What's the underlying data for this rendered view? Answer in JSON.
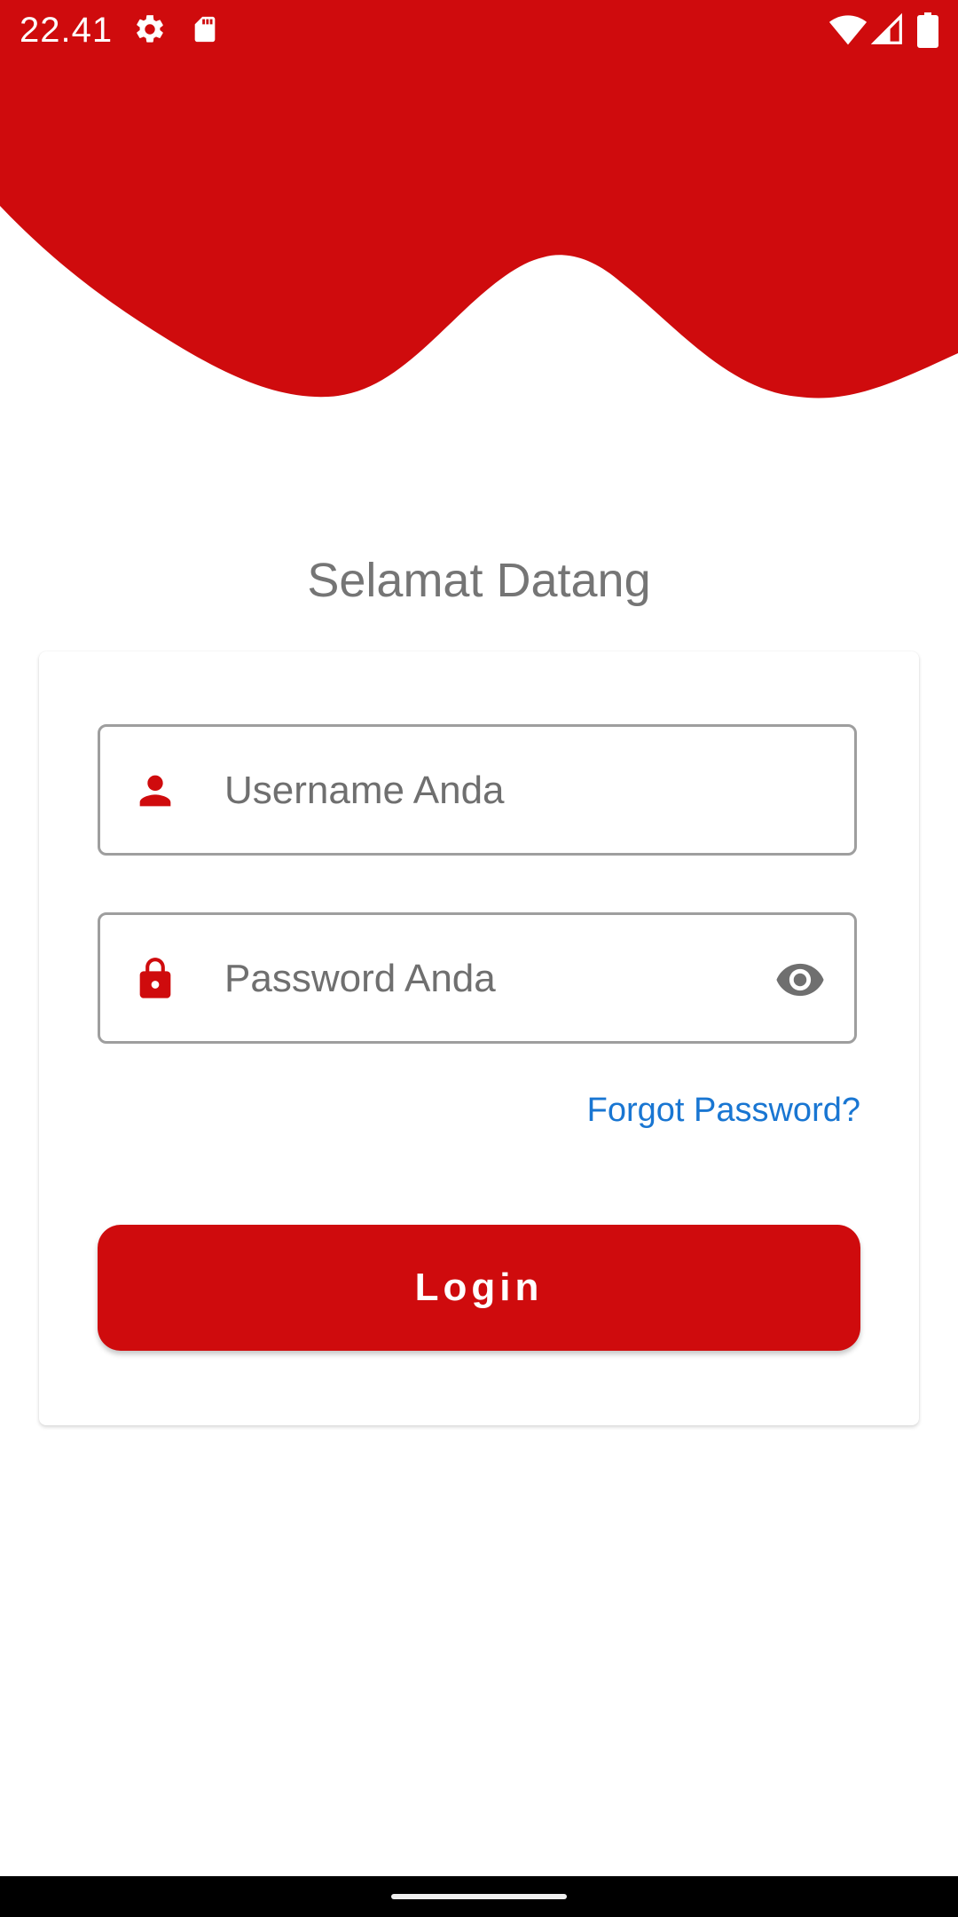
{
  "status_bar": {
    "time": "22.41",
    "icons": [
      "gear-icon",
      "sd-card-icon",
      "wifi-icon",
      "signal-icon",
      "battery-icon"
    ]
  },
  "header": {
    "wave_color": "#cf0b0d"
  },
  "welcome_title": "Selamat Datang",
  "login_form": {
    "username": {
      "placeholder": "Username Anda",
      "value": "",
      "icon": "person-icon"
    },
    "password": {
      "placeholder": "Password Anda",
      "value": "",
      "icon": "lock-icon",
      "toggle_icon": "eye-icon"
    },
    "forgot_password_label": "Forgot Password?",
    "login_button_label": "Login"
  },
  "colors": {
    "brand_red": "#cf0b0d",
    "link_blue": "#1976d2",
    "placeholder_gray": "#6f6f6f",
    "title_gray": "#757575",
    "field_border": "#9e9e9e"
  }
}
